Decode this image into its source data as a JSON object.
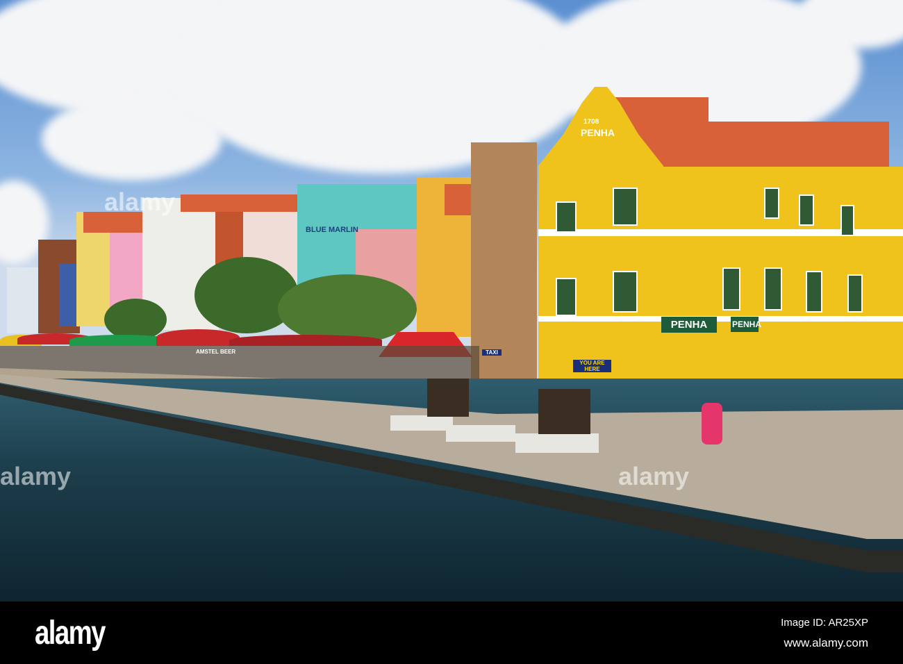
{
  "photo": {
    "subject": "Punda waterfront buildings",
    "signs": {
      "penha_gable_year": "1708",
      "penha_gable": "PENHA",
      "penha_sign_left": "PENHA",
      "penha_sign_right": "PENHA",
      "blue_marlin": "BLUE MARLIN",
      "amstel": "AMSTEL BEER",
      "taxi": "TAXI",
      "you_are_here": "YOU ARE HERE"
    },
    "watermarks": [
      "alamy",
      "alamy",
      "alamy"
    ]
  },
  "footer": {
    "logo": "alamy",
    "image_id": "Image ID: AR25XP",
    "url": "www.alamy.com"
  },
  "colors": {
    "penha_yellow": "#f0c21c",
    "roof": "#d8613a",
    "water": "#1d3e4c"
  }
}
